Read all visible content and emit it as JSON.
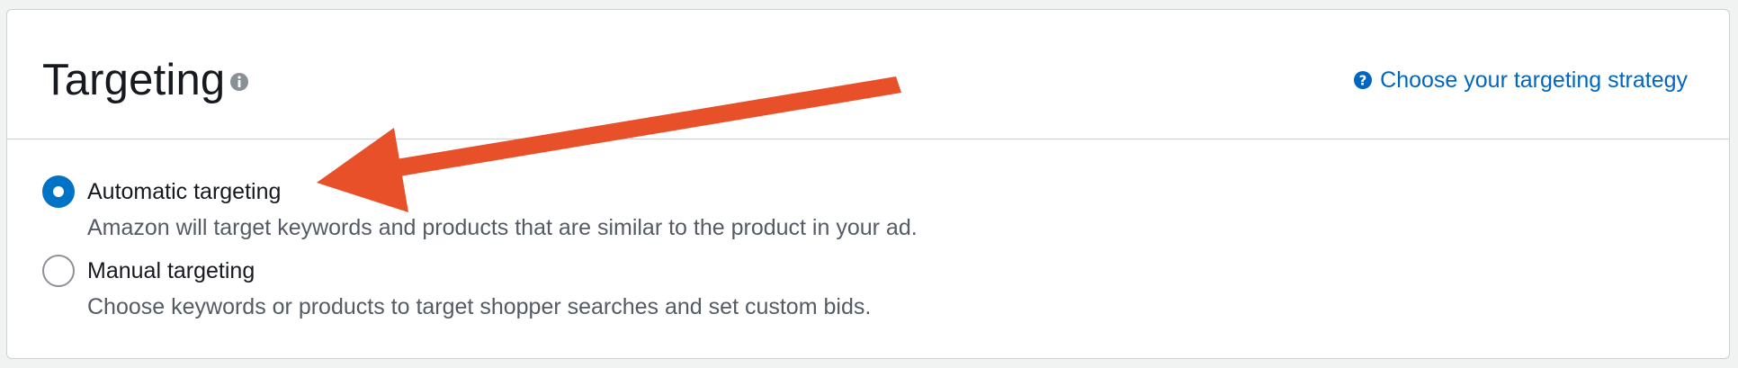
{
  "header": {
    "title": "Targeting",
    "info_icon": "info-circle-icon",
    "strategy_link_label": "Choose your targeting strategy",
    "strategy_link_icon": "question-circle-icon"
  },
  "options": [
    {
      "label": "Automatic targeting",
      "description": "Amazon will target keywords and products that are similar to the product in your ad.",
      "selected": true
    },
    {
      "label": "Manual targeting",
      "description": "Choose keywords or products to target shopper searches and set custom bids.",
      "selected": false
    }
  ],
  "annotation": {
    "type": "arrow-pointer",
    "color": "#e8502a"
  },
  "colors": {
    "link": "#0066c0",
    "radio_selected": "#0073c7",
    "border": "#cdd1d4"
  }
}
